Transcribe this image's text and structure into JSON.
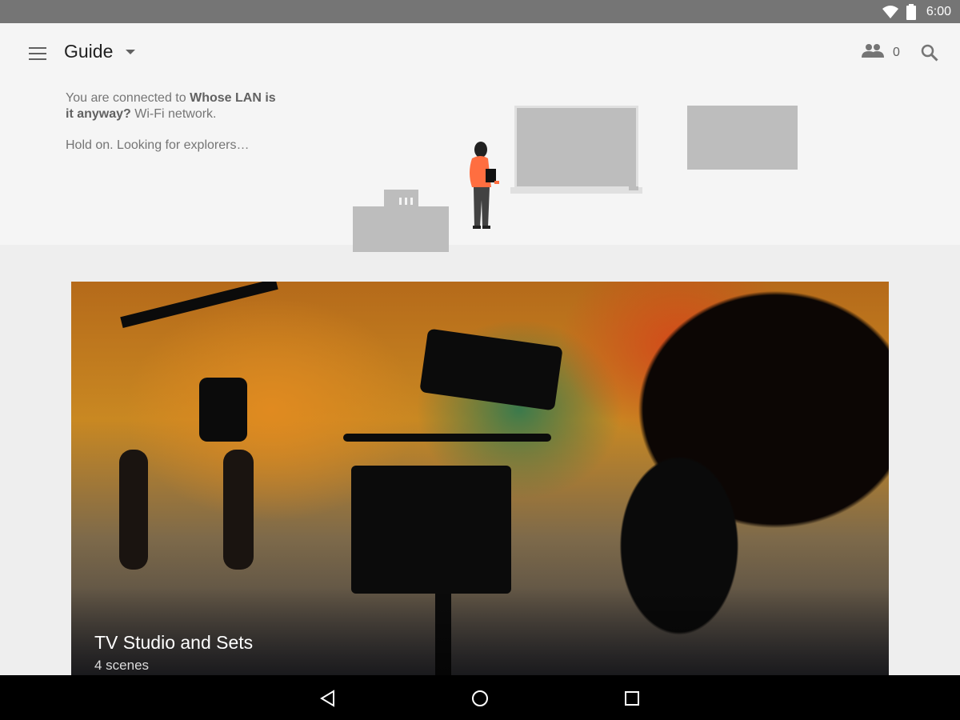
{
  "status_bar": {
    "time": "6:00"
  },
  "header": {
    "title": "Guide",
    "people_count": "0",
    "icons": {
      "menu": "hamburger-menu-icon",
      "dropdown": "caret-down-icon",
      "people": "people-icon",
      "search": "search-icon"
    }
  },
  "connection": {
    "prefix": "You are connected to ",
    "network_name": "Whose LAN is it anyway?",
    "suffix": " Wi-Fi network.",
    "status": "Hold on. Looking for explorers…"
  },
  "card": {
    "title": "TV Studio and Sets",
    "subtitle": "4 scenes"
  },
  "nav_bar": {
    "icons": [
      "back-icon",
      "home-icon",
      "recents-icon"
    ]
  },
  "colors": {
    "person_shirt": "#ff7043",
    "illustration_gray": "#bdbdbd",
    "header_bg": "#f5f5f5"
  }
}
